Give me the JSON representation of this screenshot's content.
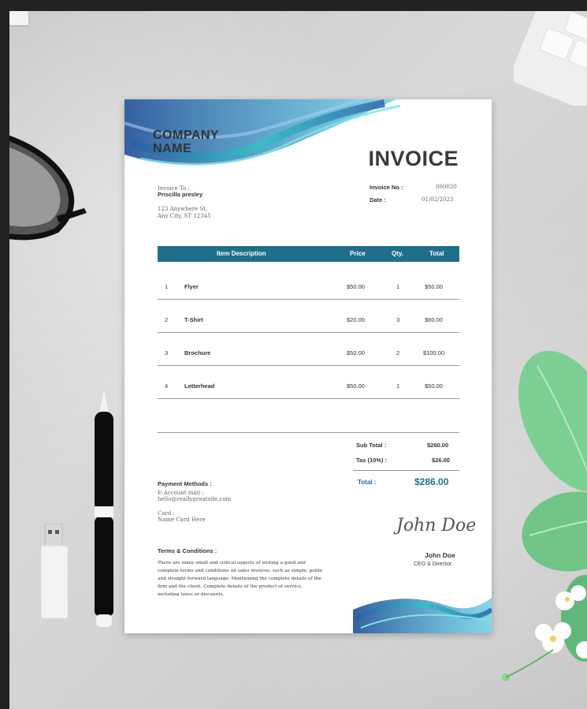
{
  "invoice": {
    "company_line1": "COMPANY",
    "company_line2": "NAME",
    "title": "INVOICE",
    "invoice_to_label": "Invoice To :",
    "client_name": "Priscilla presley",
    "client_address1": "123 Anywhere St.",
    "client_address2": "Any City, ST 12345",
    "invoice_no_label": "Invoice No :",
    "invoice_no": "000020",
    "date_label": "Date :",
    "date": "01/02/2023",
    "table_headers": [
      "Item Description",
      "Price",
      "Qty.",
      "Total"
    ],
    "items": [
      {
        "no": "1",
        "desc": "Flyer",
        "price": "$50.00",
        "qty": "1",
        "total": "$50.00"
      },
      {
        "no": "2",
        "desc": "T-Shirt",
        "price": "$20.00",
        "qty": "3",
        "total": "$60.00"
      },
      {
        "no": "3",
        "desc": "Brochure",
        "price": "$50.00",
        "qty": "2",
        "total": "$100.00"
      },
      {
        "no": "4",
        "desc": "Letterhead",
        "price": "$50.00",
        "qty": "1",
        "total": "$50.00"
      }
    ],
    "subtotal_label": "Sub Total :",
    "subtotal": "$260.00",
    "tax_label": "Tax (10%) :",
    "tax": "$26.00",
    "total_label": "Total :",
    "total": "$286.00",
    "payment_title": "Payment Methods :",
    "payment_line1": "E-Account mail :",
    "payment_line2": "hello@reallygreatsite.com",
    "payment_line3": "Card :",
    "payment_line4": "Name Card Here",
    "terms_title": "Terms & Conditions :",
    "terms_text": "There are many small and critical aspects of writing a good and complete terms and conditions on sales invoices, such as simple, polite and straight forward language. Mentioning the complete details of the firm and the client. Complete details of the product of service, including taxes or discounts.",
    "signature": "John Doe",
    "signer_name": "John Doe",
    "signer_title": "CEO & Director"
  },
  "colors": {
    "accent": "#1f6f8b",
    "wave_teal": "#2ec4c4",
    "wave_blue": "#2a5fa8"
  }
}
